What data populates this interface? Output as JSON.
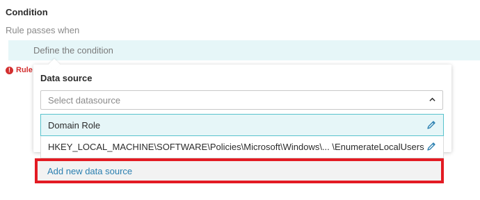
{
  "condition": {
    "title": "Condition",
    "subtitle": "Rule passes when",
    "define_placeholder": "Define the condition",
    "error_text": "Rule"
  },
  "datasource_panel": {
    "label": "Data source",
    "select_placeholder": "Select datasource",
    "options": [
      {
        "label": "Domain Role",
        "selected": true
      },
      {
        "label": "HKEY_LOCAL_MACHINE\\SOFTWARE\\Policies\\Microsoft\\Windows\\... \\EnumerateLocalUsers",
        "selected": false
      }
    ],
    "add_new_label": "Add new data source"
  },
  "colors": {
    "accent_teal": "#57c2cc",
    "highlight_bg": "#e6f6f8",
    "link": "#2a7fb0",
    "error": "#d32f2f",
    "annotation_red": "#e31b23"
  },
  "icons": {
    "select_chevron": "chevron-up-icon",
    "edit": "pencil-icon",
    "error": "exclamation-circle-icon"
  }
}
